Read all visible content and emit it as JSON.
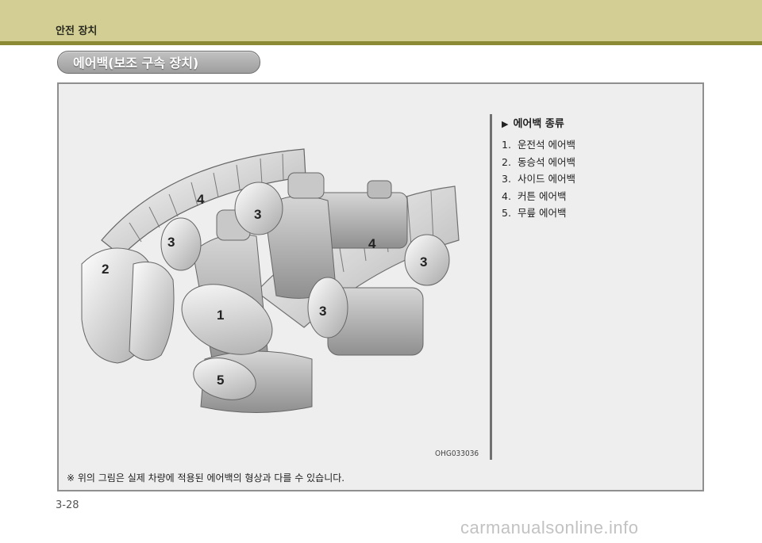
{
  "header": {
    "chapter_title": "안전 장치"
  },
  "section": {
    "title": "에어백(보조 구속 장치)"
  },
  "figure": {
    "code": "OHG033036",
    "callouts": [
      {
        "number": "1"
      },
      {
        "number": "2"
      },
      {
        "number": "3"
      },
      {
        "number": "3"
      },
      {
        "number": "3"
      },
      {
        "number": "3"
      },
      {
        "number": "4"
      },
      {
        "number": "4"
      },
      {
        "number": "5"
      }
    ]
  },
  "airbag_types": {
    "heading": "에어백 종류",
    "items": [
      {
        "number": "1.",
        "label": "운전석 에어백"
      },
      {
        "number": "2.",
        "label": "동승석 에어백"
      },
      {
        "number": "3.",
        "label": "사이드 에어백"
      },
      {
        "number": "4.",
        "label": "커튼 에어백"
      },
      {
        "number": "5.",
        "label": "무릎 에어백"
      }
    ]
  },
  "note": "※ 위의 그림은 실제 차량에 적용된 에어백의 형상과 다를 수 있습니다.",
  "page_number": "3-28",
  "watermark": "carmanualsonline.info"
}
